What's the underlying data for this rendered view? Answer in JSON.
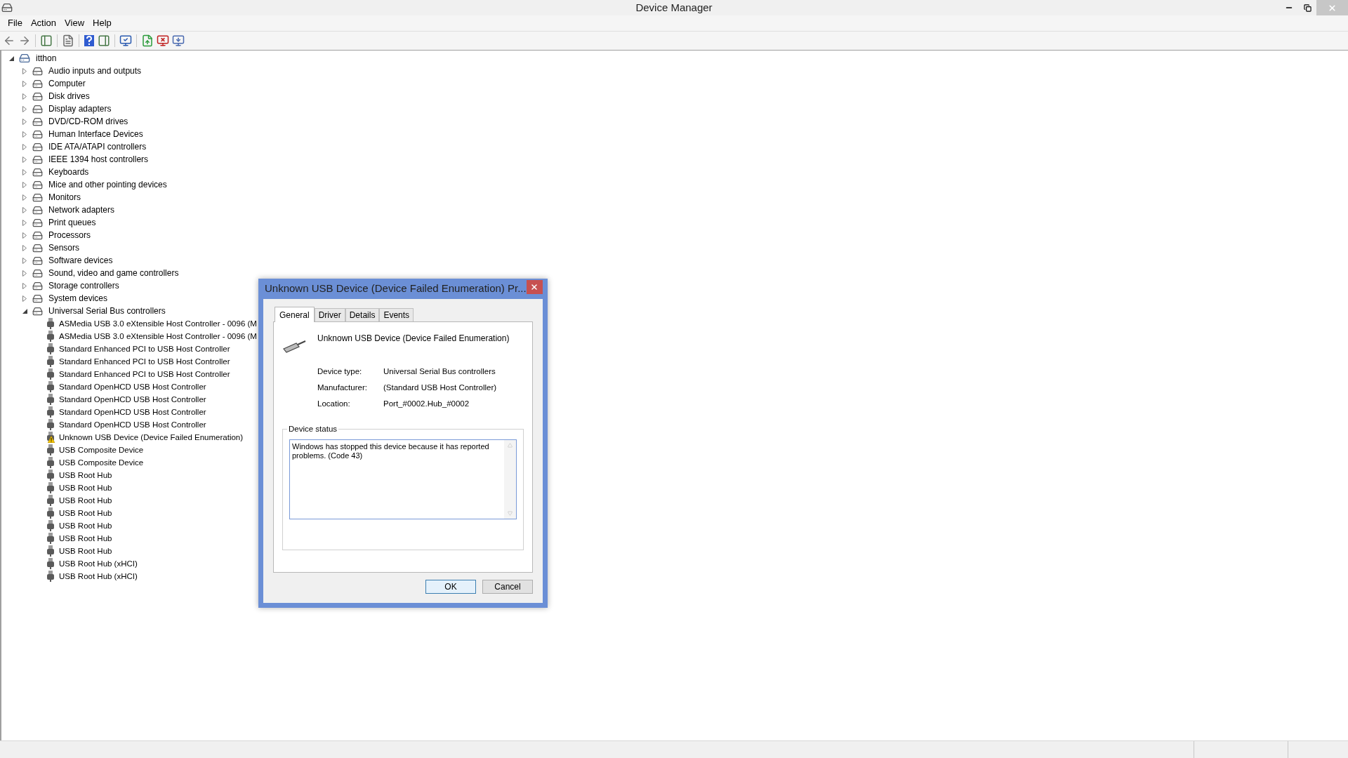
{
  "window": {
    "title": "Device Manager"
  },
  "menu": [
    "File",
    "Action",
    "View",
    "Help"
  ],
  "tree": {
    "label": "itthon",
    "expanded": true,
    "children": [
      {
        "label": "Audio inputs and outputs",
        "expanded": false
      },
      {
        "label": "Computer",
        "expanded": false
      },
      {
        "label": "Disk drives",
        "expanded": false
      },
      {
        "label": "Display adapters",
        "expanded": false
      },
      {
        "label": "DVD/CD-ROM drives",
        "expanded": false
      },
      {
        "label": "Human Interface Devices",
        "expanded": false
      },
      {
        "label": "IDE ATA/ATAPI controllers",
        "expanded": false
      },
      {
        "label": "IEEE 1394 host controllers",
        "expanded": false
      },
      {
        "label": "Keyboards",
        "expanded": false
      },
      {
        "label": "Mice and other pointing devices",
        "expanded": false
      },
      {
        "label": "Monitors",
        "expanded": false
      },
      {
        "label": "Network adapters",
        "expanded": false
      },
      {
        "label": "Print queues",
        "expanded": false
      },
      {
        "label": "Processors",
        "expanded": false
      },
      {
        "label": "Sensors",
        "expanded": false
      },
      {
        "label": "Software devices",
        "expanded": false
      },
      {
        "label": "Sound, video and game controllers",
        "expanded": false
      },
      {
        "label": "Storage controllers",
        "expanded": false
      },
      {
        "label": "System devices",
        "expanded": false
      },
      {
        "label": "Universal Serial Bus controllers",
        "expanded": true,
        "children": [
          {
            "label": "ASMedia USB 3.0 eXtensible Host Controller - 0096 (M",
            "warning": false
          },
          {
            "label": "ASMedia USB 3.0 eXtensible Host Controller - 0096 (M",
            "warning": false
          },
          {
            "label": "Standard Enhanced PCI to USB Host Controller",
            "warning": false
          },
          {
            "label": "Standard Enhanced PCI to USB Host Controller",
            "warning": false
          },
          {
            "label": "Standard Enhanced PCI to USB Host Controller",
            "warning": false
          },
          {
            "label": "Standard OpenHCD USB Host Controller",
            "warning": false
          },
          {
            "label": "Standard OpenHCD USB Host Controller",
            "warning": false
          },
          {
            "label": "Standard OpenHCD USB Host Controller",
            "warning": false
          },
          {
            "label": "Standard OpenHCD USB Host Controller",
            "warning": false
          },
          {
            "label": "Unknown USB Device (Device Failed Enumeration)",
            "warning": true
          },
          {
            "label": "USB Composite Device",
            "warning": false
          },
          {
            "label": "USB Composite Device",
            "warning": false
          },
          {
            "label": "USB Root Hub",
            "warning": false
          },
          {
            "label": "USB Root Hub",
            "warning": false
          },
          {
            "label": "USB Root Hub",
            "warning": false
          },
          {
            "label": "USB Root Hub",
            "warning": false
          },
          {
            "label": "USB Root Hub",
            "warning": false
          },
          {
            "label": "USB Root Hub",
            "warning": false
          },
          {
            "label": "USB Root Hub",
            "warning": false
          },
          {
            "label": "USB Root Hub (xHCI)",
            "warning": false
          },
          {
            "label": "USB Root Hub (xHCI)",
            "warning": false
          }
        ]
      }
    ]
  },
  "dialog": {
    "title": "Unknown USB Device (Device Failed Enumeration) Pr...",
    "tabs": [
      {
        "label": "General",
        "selected": true
      },
      {
        "label": "Driver",
        "selected": false
      },
      {
        "label": "Details",
        "selected": false
      },
      {
        "label": "Events",
        "selected": false
      }
    ],
    "device_name": "Unknown USB Device (Device Failed Enumeration)",
    "properties": [
      {
        "label": "Device type:",
        "value": "Universal Serial Bus controllers"
      },
      {
        "label": "Manufacturer:",
        "value": "(Standard USB Host Controller)"
      },
      {
        "label": "Location:",
        "value": "Port_#0002.Hub_#0002"
      }
    ],
    "status_group": "Device status",
    "status_text": "Windows has stopped this device because it has reported problems. (Code 43)",
    "buttons": [
      {
        "label": "OK",
        "default": true
      },
      {
        "label": "Cancel",
        "default": false
      }
    ]
  }
}
